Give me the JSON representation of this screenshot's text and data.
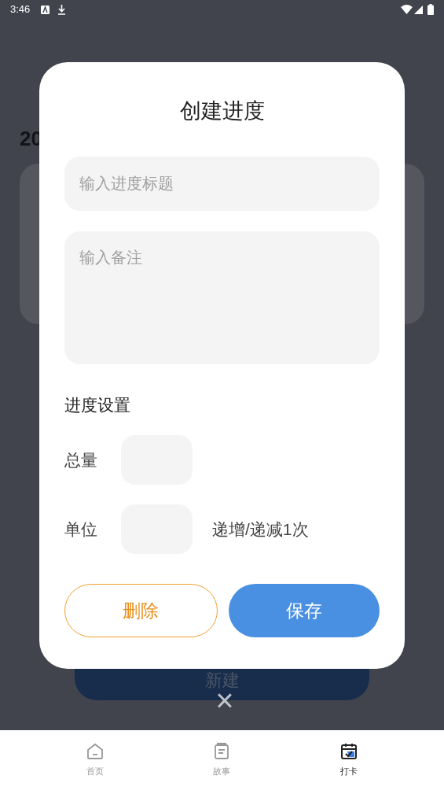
{
  "status_bar": {
    "time": "3:46"
  },
  "background": {
    "heading": "20",
    "new_button": "新建"
  },
  "dialog": {
    "title": "创建进度",
    "title_field": {
      "placeholder": "输入进度标题"
    },
    "note_field": {
      "placeholder": "输入备注"
    },
    "section": "进度设置",
    "rows": [
      {
        "label": "总量"
      },
      {
        "label": "单位",
        "suffix": "递增/递减1次"
      }
    ],
    "buttons": [
      {
        "label": "删除",
        "kind": "outline"
      },
      {
        "label": "保存",
        "kind": "primary"
      }
    ]
  },
  "close": "×",
  "tabs": [
    {
      "label": "首页",
      "kind": "home",
      "selected": false
    },
    {
      "label": "故事",
      "kind": "doc",
      "selected": false
    },
    {
      "label": "打卡",
      "kind": "calendar",
      "selected": true
    }
  ]
}
